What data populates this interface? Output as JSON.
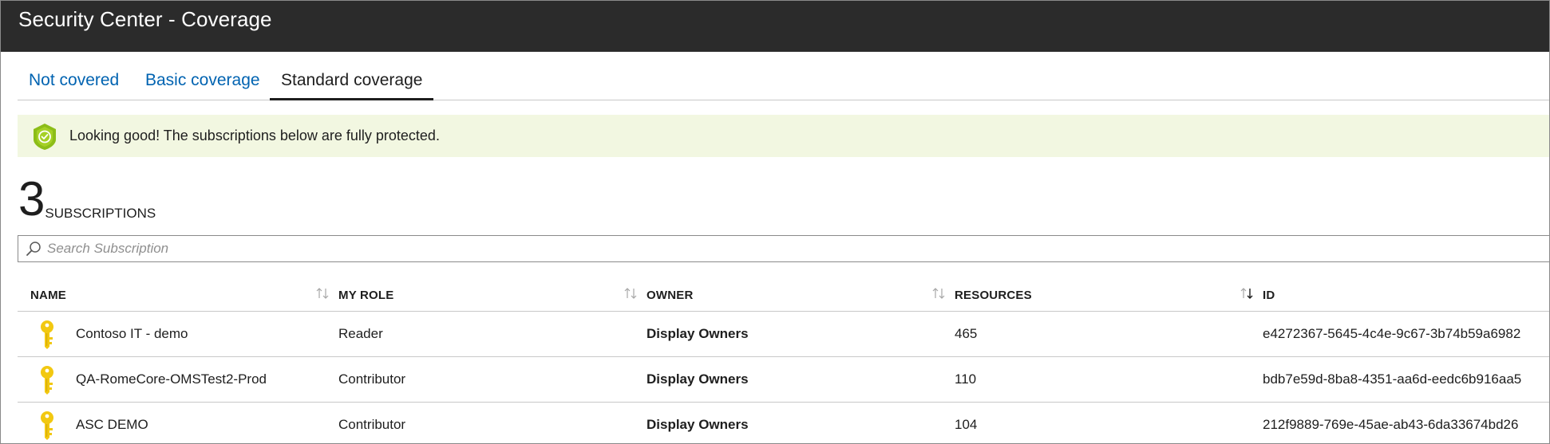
{
  "window": {
    "title": "Security Center - Coverage"
  },
  "tabs": [
    {
      "label": "Not covered",
      "active": false
    },
    {
      "label": "Basic coverage",
      "active": false
    },
    {
      "label": "Standard coverage",
      "active": true
    }
  ],
  "banner": {
    "icon": "shield-check-icon",
    "message": "Looking good! The subscriptions below are fully protected.",
    "background": "#f2f7e1",
    "icon_color": "#8cbd18"
  },
  "summary": {
    "count": "3",
    "label": "SUBSCRIPTIONS"
  },
  "search": {
    "placeholder": "Search Subscription",
    "value": "",
    "icon": "search-icon"
  },
  "table": {
    "columns": [
      {
        "label": "NAME",
        "sort_icon": "sort-icon"
      },
      {
        "label": "MY ROLE",
        "sort_icon": "sort-icon"
      },
      {
        "label": "OWNER",
        "sort_icon": "sort-icon"
      },
      {
        "label": "RESOURCES",
        "sort_icon": "sort-descending-icon"
      },
      {
        "label": "ID"
      }
    ],
    "rows": [
      {
        "icon": "key-icon",
        "name": "Contoso IT - demo",
        "role": "Reader",
        "owner": "Display Owners",
        "resources": "465",
        "id": "e4272367-5645-4c4e-9c67-3b74b59a6982"
      },
      {
        "icon": "key-icon",
        "name": "QA-RomeCore-OMSTest2-Prod",
        "role": "Contributor",
        "owner": "Display Owners",
        "resources": "110",
        "id": "bdb7e59d-8ba8-4351-aa6d-eedc6b916aa5"
      },
      {
        "icon": "key-icon",
        "name": "ASC DEMO",
        "role": "Contributor",
        "owner": "Display Owners",
        "resources": "104",
        "id": "212f9889-769e-45ae-ab43-6da33674bd26"
      }
    ]
  },
  "colors": {
    "titlebar": "#2b2b2b",
    "link": "#0063b1",
    "key": "#f2c811"
  }
}
